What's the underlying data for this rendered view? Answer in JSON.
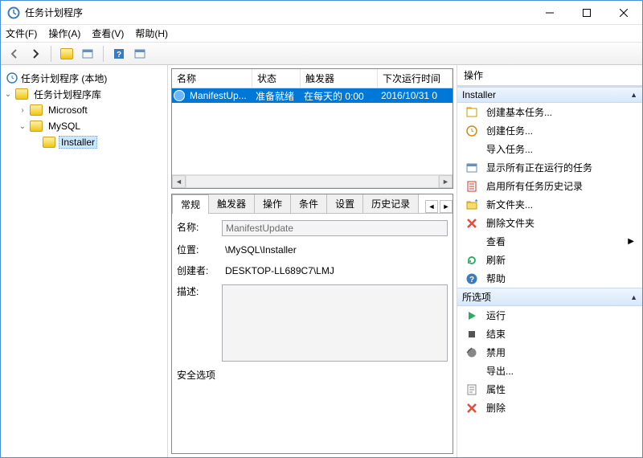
{
  "window": {
    "title": "任务计划程序"
  },
  "menu": {
    "file": "文件(F)",
    "action": "操作(A)",
    "view": "查看(V)",
    "help": "帮助(H)"
  },
  "tree": {
    "root": "任务计划程序 (本地)",
    "lib": "任务计划程序库",
    "microsoft": "Microsoft",
    "mysql": "MySQL",
    "installer": "Installer"
  },
  "list": {
    "hdr_name": "名称",
    "hdr_status": "状态",
    "hdr_trigger": "触发器",
    "hdr_next": "下次运行时间",
    "row": {
      "name": "ManifestUp...",
      "status": "准备就绪",
      "trigger": "在每天的 0:00",
      "next": "2016/10/31 0"
    }
  },
  "tabs": {
    "general": "常规",
    "trigger": "触发器",
    "action": "操作",
    "cond": "条件",
    "setting": "设置",
    "history": "历史记录"
  },
  "form": {
    "name_l": "名称:",
    "name_v": "ManifestUpdate",
    "loc_l": "位置:",
    "loc_v": "\\MySQL\\Installer",
    "creator_l": "创建者:",
    "creator_v": "DESKTOP-LL689C7\\LMJ",
    "desc_l": "描述:",
    "secopt": "安全选项"
  },
  "actions": {
    "pane_title": "操作",
    "section1": "Installer",
    "create_basic": "创建基本任务...",
    "create": "创建任务...",
    "import": "导入任务...",
    "show_running": "显示所有正在运行的任务",
    "enable_history": "启用所有任务历史记录",
    "new_folder": "新文件夹...",
    "delete_folder": "删除文件夹",
    "view": "查看",
    "refresh": "刷新",
    "help": "帮助",
    "section2": "所选项",
    "run": "运行",
    "end": "结束",
    "disable": "禁用",
    "export": "导出...",
    "props": "属性",
    "delete": "删除"
  }
}
